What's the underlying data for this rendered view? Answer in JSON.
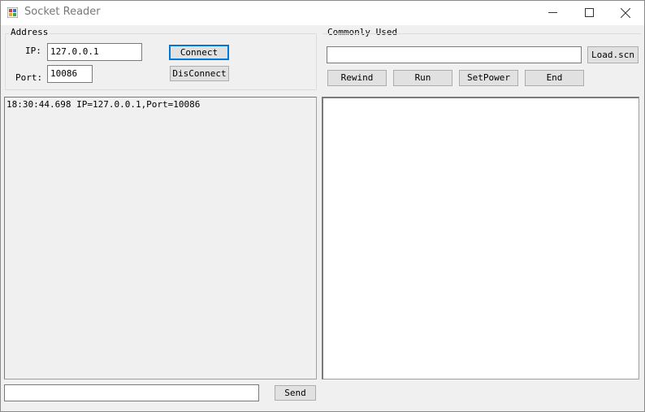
{
  "window": {
    "title": "Socket Reader",
    "icon": "window-app-icon",
    "controls": [
      "minimize-icon",
      "maximize-icon",
      "close-icon"
    ]
  },
  "address_group": {
    "legend": "Address",
    "ip_label": "IP:",
    "ip_value": "127.0.0.1",
    "port_label": "Port:",
    "port_value": "10086",
    "connect_label": "Connect",
    "disconnect_label": "DisConnect"
  },
  "common_group": {
    "legend": "Commonly Used",
    "script_value": "",
    "load_label": "Load.scn",
    "buttons": [
      "Rewind",
      "Run",
      "SetPower",
      "End"
    ]
  },
  "log": {
    "lines": [
      "18:30:44.698 IP=127.0.0.1,Port=10086"
    ]
  },
  "send_bar": {
    "input_value": "",
    "send_label": "Send"
  }
}
